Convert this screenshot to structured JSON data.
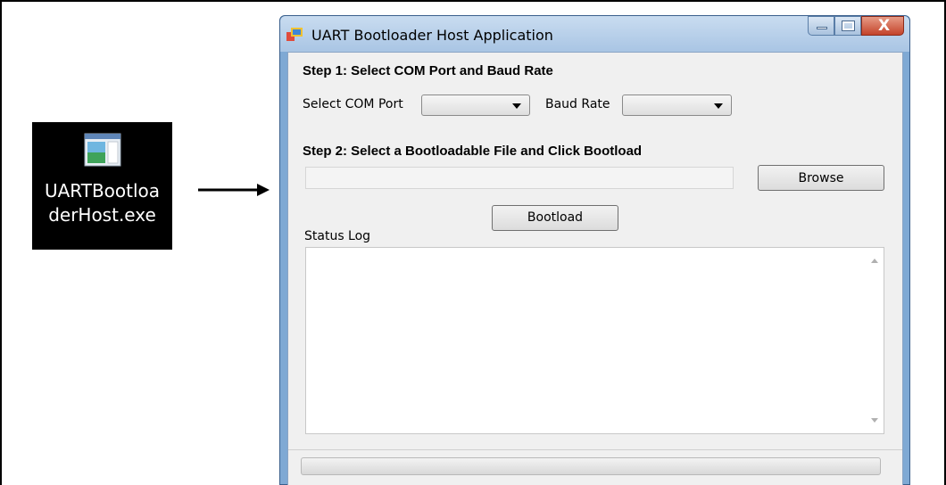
{
  "desktop": {
    "icon_name": "application-icon",
    "label_line1": "UARTBootloa",
    "label_line2": "derHost.exe"
  },
  "window": {
    "title": "UART Bootloader Host Application",
    "controls": [
      "minimize",
      "maximize",
      "close"
    ],
    "close_glyph": "X"
  },
  "step1": {
    "heading": "Step 1: Select COM Port and Baud Rate",
    "com_label": "Select COM Port",
    "com_value": "",
    "baud_label": "Baud Rate",
    "baud_value": ""
  },
  "step2": {
    "heading": "Step 2: Select a Bootloadable File and Click Bootload",
    "file_path": "",
    "browse_label": "Browse",
    "bootload_label": "Bootload"
  },
  "status_log": {
    "label": "Status Log",
    "content": ""
  },
  "progress": {
    "value": 0
  }
}
